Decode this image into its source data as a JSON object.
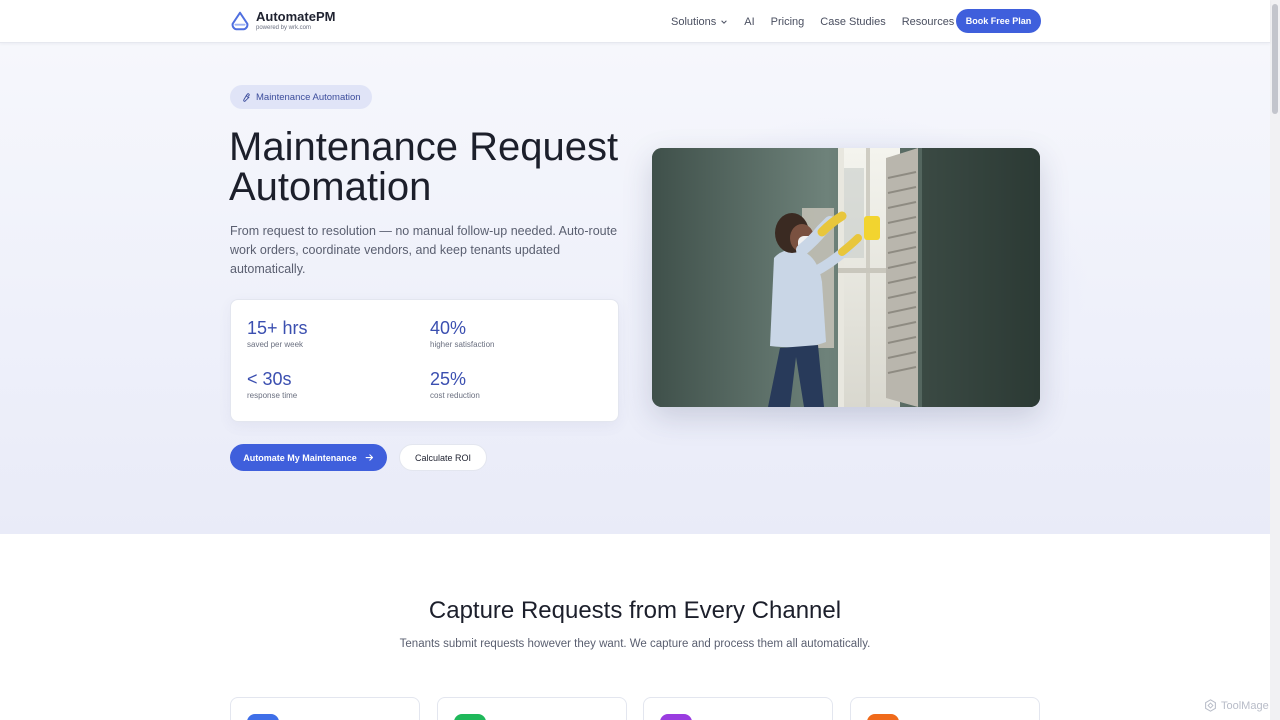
{
  "brand": {
    "name": "AutomatePM",
    "sub": "powered by wrk.com"
  },
  "nav": {
    "links": [
      "Solutions",
      "AI",
      "Pricing",
      "Case Studies",
      "Resources"
    ],
    "cta": "Book Free Plan"
  },
  "hero": {
    "badge": "Maintenance Automation",
    "title": "Maintenance Request Automation",
    "description": "From request to resolution — no manual follow-up needed. Auto-route work orders, coordinate vendors, and keep tenants updated automatically.",
    "stats": [
      {
        "value": "15+ hrs",
        "label": "saved per week"
      },
      {
        "value": "40%",
        "label": "higher satisfaction"
      },
      {
        "value": "< 30s",
        "label": "response time"
      },
      {
        "value": "25%",
        "label": "cost reduction"
      }
    ],
    "primary_cta": "Automate My Maintenance",
    "secondary_cta": "Calculate ROI"
  },
  "section": {
    "title": "Capture Requests from Every Channel",
    "subtitle": "Tenants submit requests however they want. We capture and process them all automatically."
  },
  "cards": [
    {
      "icon": "channel-icon-blue",
      "color": "#3f6fe8"
    },
    {
      "icon": "channel-icon-green",
      "color": "#1fb85a"
    },
    {
      "icon": "channel-icon-purple",
      "color": "#9a3ce0"
    },
    {
      "icon": "channel-icon-orange",
      "color": "#f06a1a"
    }
  ],
  "colors": {
    "accent": "#3f5fdc",
    "stat": "#3b4fb0"
  },
  "watermark": "ToolMage"
}
